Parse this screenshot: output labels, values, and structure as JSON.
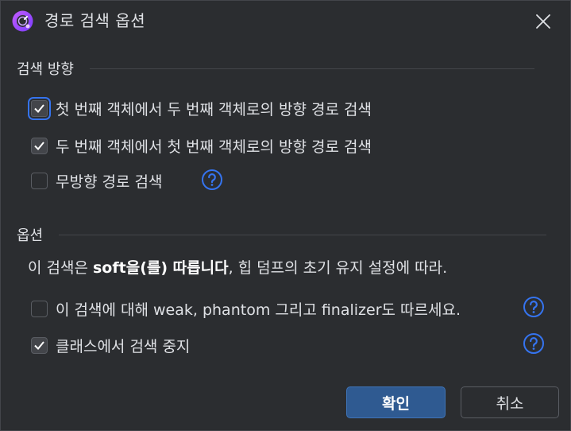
{
  "window": {
    "title": "경로 검색 옵션"
  },
  "sections": {
    "direction": {
      "header": "검색 방향",
      "options": [
        {
          "label": "첫 번째 객체에서 두 번째 객체로의 방향 경로 검색",
          "checked": true
        },
        {
          "label": "두 번째 객체에서 첫 번째 객체로의 방향 경로 검색",
          "checked": true
        },
        {
          "label": "무방향 경로 검색",
          "checked": false
        }
      ]
    },
    "options": {
      "header": "옵션",
      "info_prefix": "이 검색은 ",
      "info_bold": "soft을(를) 따릅니다",
      "info_suffix": ", 힙 덤프의 초기 유지 설정에 따라.",
      "items": [
        {
          "label": "이 검색에 대해 weak, phantom 그리고 finalizer도 따르세요.",
          "checked": false
        },
        {
          "label": "클래스에서 검색 중지",
          "checked": true
        }
      ]
    }
  },
  "buttons": {
    "ok": "확인",
    "cancel": "취소"
  },
  "colors": {
    "background": "#2b2d30",
    "accent": "#3574f0",
    "primary_button": "#2f5a91",
    "help_icon": "#3574f0"
  }
}
